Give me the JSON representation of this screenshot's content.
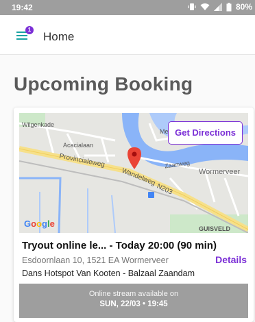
{
  "status_bar": {
    "time": "19:42",
    "battery": "80%",
    "icons": [
      "vibrate-icon",
      "wifi-icon",
      "signal-icon",
      "battery-icon"
    ]
  },
  "app_bar": {
    "title": "Home",
    "menu_badge": "1",
    "accent": "#1aa3a3",
    "badge_color": "#7b2fd6"
  },
  "section": {
    "title": "Upcoming Booking"
  },
  "booking": {
    "title": "Tryout online le...  - Today 20:00 (90 min)",
    "address": "Esdoornlaan 10, 1521 EA Wormerveer",
    "details_label": "Details",
    "venue": "Dans Hotspot Van Kooten - Balzaal Zaandam",
    "stream_line1": "Online stream available on",
    "stream_line2": "SUN, 22/03 • 19:45",
    "accent": "#7b2fd6"
  },
  "map": {
    "directions_label": "Get Directions",
    "labels": {
      "wilgenkade": "Wilgenkade",
      "acacialaan": "Acacialaan",
      "provincialeweg": "Provincialeweg",
      "wandelweg": "Wandelweg",
      "n203": "N203",
      "zaanweg": "Zaanweg",
      "wormerveer": "Wormerveer",
      "guisveld": "GUISVELD",
      "me": "Me"
    },
    "logo": [
      "G",
      "o",
      "o",
      "g",
      "l",
      "e"
    ]
  }
}
